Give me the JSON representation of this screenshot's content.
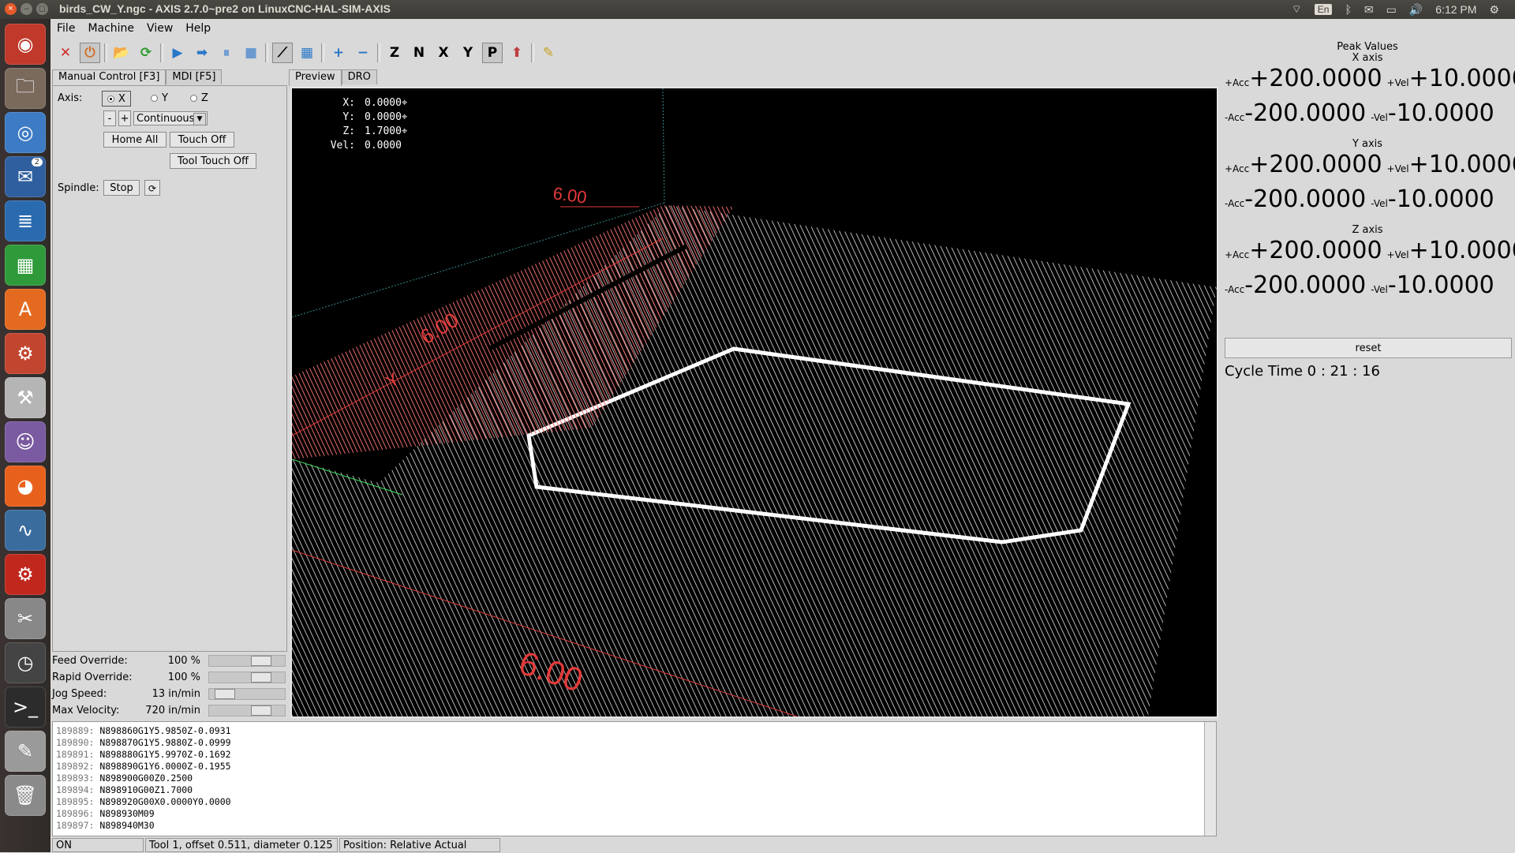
{
  "top_panel": {
    "window_title": "birds_CW_Y.ngc - AXIS 2.7.0~pre2 on LinuxCNC-HAL-SIM-AXIS",
    "keyboard_layout": "En",
    "clock": "6:12 PM"
  },
  "launcher": {
    "items": [
      {
        "name": "ubuntu-dash",
        "color": "#c0392b"
      },
      {
        "name": "files",
        "color": "#7a6a5c"
      },
      {
        "name": "chromium",
        "color": "#3d7bc4"
      },
      {
        "name": "thunderbird",
        "color": "#2f5f9e",
        "badge": "2"
      },
      {
        "name": "writer",
        "color": "#2a6bb0"
      },
      {
        "name": "calc",
        "color": "#2f9a3a"
      },
      {
        "name": "software-center",
        "color": "#e36a1f"
      },
      {
        "name": "system-settings",
        "color": "#c24530"
      },
      {
        "name": "tools",
        "color": "#b5b5b5"
      },
      {
        "name": "pidgin",
        "color": "#7a5aa0"
      },
      {
        "name": "firefox",
        "color": "#e8611c"
      },
      {
        "name": "system-monitor",
        "color": "#3a6d9e"
      },
      {
        "name": "filezilla",
        "color": "#c0281e"
      },
      {
        "name": "linuxcnc",
        "color": "#888888"
      },
      {
        "name": "clock",
        "color": "#444444"
      },
      {
        "name": "terminal",
        "color": "#2c2c2c"
      },
      {
        "name": "text-editor",
        "color": "#9a9a9a"
      },
      {
        "name": "trash",
        "color": "#8a8a8a"
      }
    ]
  },
  "menubar": [
    "File",
    "Machine",
    "View",
    "Help"
  ],
  "toolbar": [
    "✕",
    "⏻",
    "📂",
    "⟳",
    "▶",
    "➡",
    "⏸",
    "■",
    "⟋",
    "▦",
    "+",
    "−",
    "Z",
    "N",
    "X",
    "Y",
    "P",
    "⬆",
    "✎"
  ],
  "left_tabs": [
    "Manual Control [F3]",
    "MDI [F5]"
  ],
  "manual": {
    "axis_label": "Axis:",
    "axes": [
      "X",
      "Y",
      "Z"
    ],
    "minus": "-",
    "plus": "+",
    "jog_mode": "Continuous",
    "home_all": "Home All",
    "touch_off": "Touch Off",
    "tool_touch_off": "Tool Touch Off",
    "spindle_label": "Spindle:",
    "spindle_stop": "Stop"
  },
  "overrides": [
    {
      "label": "Feed Override:",
      "value": "100 %",
      "position": 0.75
    },
    {
      "label": "Rapid Override:",
      "value": "100 %",
      "position": 0.75
    },
    {
      "label": "Jog Speed:",
      "value": "13 in/min",
      "position": 0.1
    },
    {
      "label": "Max Velocity:",
      "value": "720 in/min",
      "position": 0.75
    }
  ],
  "view_tabs": [
    "Preview",
    "DRO"
  ],
  "dro": [
    {
      "label": "X:",
      "value": "0.0000"
    },
    {
      "label": "Y:",
      "value": "0.0000"
    },
    {
      "label": "Z:",
      "value": "1.7000"
    },
    {
      "label": "Vel:",
      "value": "0.0000"
    }
  ],
  "dimension_labels": [
    "6.00",
    "6.00",
    "6.00",
    "Y"
  ],
  "peak": {
    "title": "Peak Values",
    "axes": [
      {
        "name": "X axis",
        "pos_acc_lbl": "+Acc",
        "pos_acc": "+200.0000",
        "pos_vel_lbl": "+Vel",
        "pos_vel": "+10.0000",
        "neg_acc_lbl": "-Acc",
        "neg_acc": "-200.0000",
        "neg_vel_lbl": "-Vel",
        "neg_vel": "-10.0000"
      },
      {
        "name": "Y axis",
        "pos_acc_lbl": "+Acc",
        "pos_acc": "+200.0000",
        "pos_vel_lbl": "+Vel",
        "pos_vel": "+10.0000",
        "neg_acc_lbl": "-Acc",
        "neg_acc": "-200.0000",
        "neg_vel_lbl": "-Vel",
        "neg_vel": "-10.0000"
      },
      {
        "name": "Z axis",
        "pos_acc_lbl": "+Acc",
        "pos_acc": "+200.0000",
        "pos_vel_lbl": "+Vel",
        "pos_vel": "+10.0000",
        "neg_acc_lbl": "-Acc",
        "neg_acc": "-200.0000",
        "neg_vel_lbl": "-Vel",
        "neg_vel": "-10.0000"
      }
    ],
    "reset": "reset",
    "cycle_time": "Cycle Time  0 : 21 : 16"
  },
  "gcode_lines": [
    {
      "num": "189889:",
      "code": "N898860G1Y5.9850Z-0.0931"
    },
    {
      "num": "189890:",
      "code": "N898870G1Y5.9880Z-0.0999"
    },
    {
      "num": "189891:",
      "code": "N898880G1Y5.9970Z-0.1692"
    },
    {
      "num": "189892:",
      "code": "N898890G1Y6.0000Z-0.1955"
    },
    {
      "num": "189893:",
      "code": "N898900G00Z0.2500"
    },
    {
      "num": "189894:",
      "code": "N898910G00Z1.7000"
    },
    {
      "num": "189895:",
      "code": "N898920G00X0.0000Y0.0000"
    },
    {
      "num": "189896:",
      "code": "N898930M09"
    },
    {
      "num": "189897:",
      "code": "N898940M30"
    }
  ],
  "status": {
    "machine": "ON",
    "tool": "Tool 1, offset 0.511, diameter 0.125",
    "position": "Position: Relative Actual"
  }
}
